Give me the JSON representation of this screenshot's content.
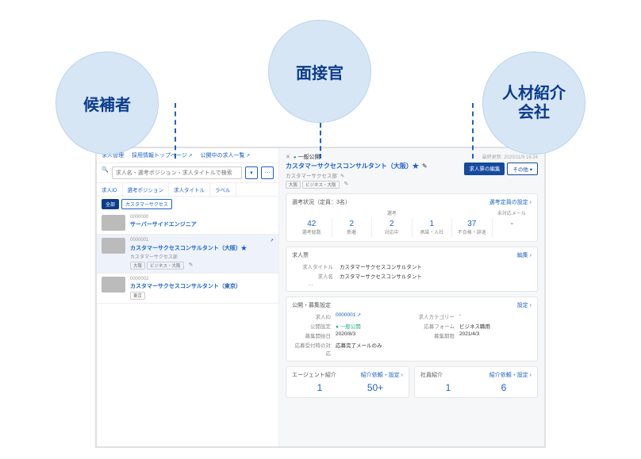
{
  "bubbles": {
    "candidate": "候補者",
    "interviewer": "面接官",
    "agency": "人材紹介\n会社"
  },
  "nav": {
    "manage": "求人管理",
    "top": "採用情報トップページ",
    "list": "公開中の求人一覧"
  },
  "search": {
    "placeholder": "求人名・選考ポジション・求人タイトルで検索"
  },
  "tabs": [
    "求人ID",
    "選考ポジション",
    "求人タイトル",
    "ラベル"
  ],
  "chips": {
    "all": "全部",
    "cs": "カスタマーサクセス"
  },
  "jobs": [
    {
      "id": "0000000",
      "title": "サーバーサイドエンジニア",
      "sub": "",
      "tags": []
    },
    {
      "id": "0000001",
      "title": "カスタマーサクセスコンサルタント（大阪）★",
      "sub": "カスタマーサクセス部",
      "tags": [
        "大阪",
        "ビジネス・大阪"
      ]
    },
    {
      "id": "0000002",
      "title": "カスタマーサクセスコンサルタント（東京）",
      "sub": "",
      "tags": [
        "東京"
      ]
    }
  ],
  "detail": {
    "status": "一般公開",
    "title": "カスタマーサクセスコンサルタント（大阪）★",
    "sub": "カスタマーサクセス部",
    "tags": [
      "大阪",
      "ビジネス・大阪"
    ],
    "updated": "最終更新: 2020/11/9 16:24",
    "btn_edit": "求人票の編集",
    "btn_other": "その他 ▾"
  },
  "selection": {
    "header": "選考状況（定員：3名）",
    "link": "選考定員の設定 ›",
    "cols": [
      "",
      "選考",
      "",
      "未対応メール"
    ],
    "stats": [
      {
        "n": "42",
        "l": "選考総数"
      },
      {
        "n": "2",
        "l": "新着"
      },
      {
        "n": "2",
        "l": "対応中"
      },
      {
        "n": "1",
        "l": "承諾・入社"
      },
      {
        "n": "37",
        "l": "不合格・辞退"
      },
      {
        "n": "-",
        "l": ""
      }
    ]
  },
  "req": {
    "header": "求人票",
    "link": "編集 ›",
    "rows": [
      {
        "k": "求人タイトル",
        "v": "カスタマーサクセスコンサルタント"
      },
      {
        "k": "求人名",
        "v": "カスタマーサクセスコンサルタント"
      }
    ],
    "more": "…"
  },
  "pub": {
    "header": "公開・募集設定",
    "link": "設定 ›",
    "grid": [
      {
        "k": "求人ID",
        "v": "0000001",
        "blue": true
      },
      {
        "k": "求人カテゴリー",
        "v": "-"
      },
      {
        "k": "公開設定",
        "v": "● 一般公開"
      },
      {
        "k": "応募フォーム",
        "v": "ビジネス職用"
      },
      {
        "k": "募集開始日",
        "v": "2020/8/3"
      },
      {
        "k": "募集期限",
        "v": "2021/4/3"
      },
      {
        "k": "応募受付時の対応",
        "v": "応募完了メールのみ"
      }
    ]
  },
  "agent": {
    "header": "エージェント紹介",
    "link": "紹介依頼・設定 ›",
    "nums": [
      "1",
      "50+"
    ]
  },
  "emp": {
    "header": "社員紹介",
    "link": "紹介依頼・設定 ›",
    "nums": [
      "1",
      "6"
    ]
  }
}
